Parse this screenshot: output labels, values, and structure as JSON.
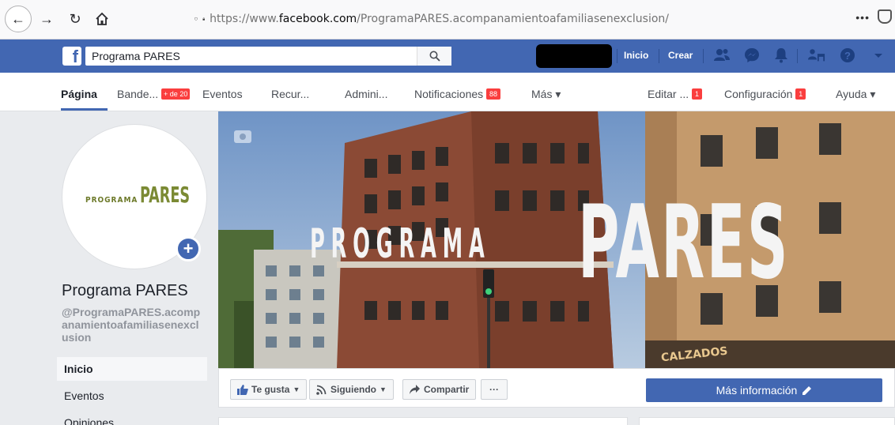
{
  "browser": {
    "url_prefix": "https://www.",
    "url_domain": "facebook.com",
    "url_path": "/ProgramaPARES.acompanamientoafamiliasenexclusion/",
    "more": "•••"
  },
  "fb_bar": {
    "logo": "f",
    "search_value": "Programa PARES",
    "inicio": "Inicio",
    "crear": "Crear"
  },
  "page_nav": {
    "pagina": "Página",
    "bandeja": "Bande...",
    "bandeja_badge": "+ de 20",
    "eventos": "Eventos",
    "recursos": "Recur...",
    "admin": "Admini...",
    "notificaciones": "Notificaciones",
    "notif_badge": "88",
    "mas": "Más ▾",
    "editar": "Editar ...",
    "editar_badge": "1",
    "configuracion": "Configuración",
    "config_badge": "1",
    "ayuda": "Ayuda ▾"
  },
  "profile": {
    "logo_small": "PROGRAMA",
    "logo_big": "PARES",
    "name": "Programa PARES",
    "handle": "@ProgramaPARES.acompanamientoafamiliasenexclusion"
  },
  "sidebar": {
    "items": [
      {
        "label": "Inicio"
      },
      {
        "label": "Eventos"
      },
      {
        "label": "Opiniones"
      }
    ]
  },
  "cover": {
    "title_left": "PROGRAMA",
    "title_right": "PARES",
    "shop_sign": "CALZADOS"
  },
  "actions": {
    "like": "Te gusta",
    "following": "Siguiendo",
    "share": "Compartir",
    "more": "···",
    "more_info": "Más información"
  }
}
